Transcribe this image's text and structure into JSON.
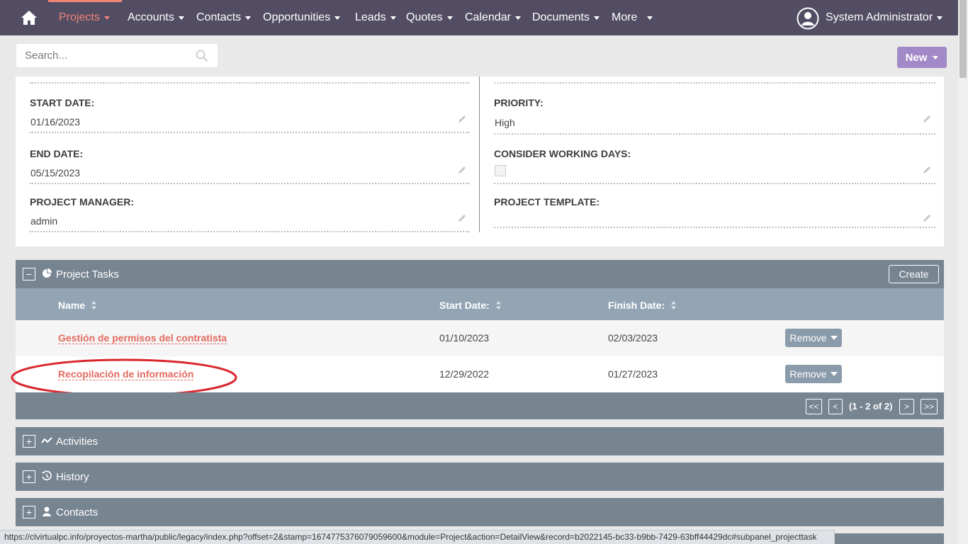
{
  "nav": {
    "items": [
      {
        "label": "Projects",
        "active": true
      },
      {
        "label": "Accounts"
      },
      {
        "label": "Contacts"
      },
      {
        "label": "Opportunities"
      },
      {
        "label": "Leads"
      },
      {
        "label": "Quotes"
      },
      {
        "label": "Calendar"
      },
      {
        "label": "Documents"
      },
      {
        "label": "More"
      }
    ],
    "user": "System Administrator"
  },
  "search": {
    "placeholder": "Search..."
  },
  "new_button": "New",
  "detail": {
    "start_date_label": "START DATE:",
    "start_date_value": "01/16/2023",
    "end_date_label": "END DATE:",
    "end_date_value": "05/15/2023",
    "manager_label": "PROJECT MANAGER:",
    "manager_value": "admin",
    "priority_label": "PRIORITY:",
    "priority_value": "High",
    "working_days_label": "CONSIDER WORKING DAYS:",
    "template_label": "PROJECT TEMPLATE:"
  },
  "project_tasks": {
    "title": "Project Tasks",
    "create_label": "Create",
    "columns": {
      "name": "Name",
      "start": "Start Date:",
      "finish": "Finish Date:"
    },
    "rows": [
      {
        "name": "Gestión de permisos del contratista",
        "start": "01/10/2023",
        "finish": "02/03/2023",
        "action": "Remove"
      },
      {
        "name": "Recopilación de información",
        "start": "12/29/2022",
        "finish": "01/27/2023",
        "action": "Remove"
      }
    ],
    "pagination": {
      "first": "<<",
      "prev": "<",
      "count": "(1 - 2 of 2)",
      "next": ">",
      "last": ">>"
    }
  },
  "subpanels": {
    "activities": "Activities",
    "history": "History",
    "contacts": "Contacts"
  },
  "status_url": "https://clvirtualpc.info/proyectos-martha/public/legacy/index.php?offset=2&stamp=1674775376079059600&module=Project&action=DetailView&record=b2022145-bc33-b9bb-7429-63bff44429dc#subpanel_projecttask",
  "colors": {
    "nav_bg": "#534d64",
    "accent": "#f08377",
    "subpanel": "#778591",
    "new_button": "#a289c7",
    "annotation": "#d9262c"
  }
}
